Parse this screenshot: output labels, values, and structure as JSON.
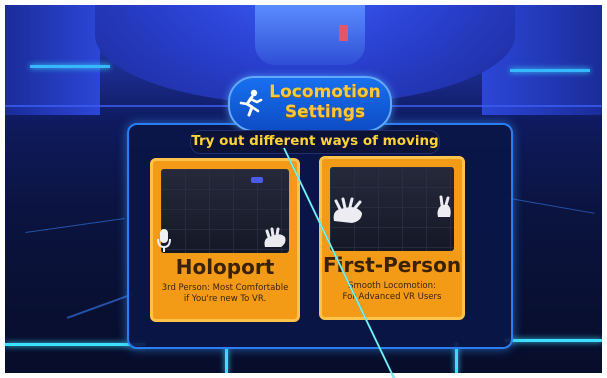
{
  "panel": {
    "title": "Locomotion Settings",
    "title_line1": "Locomotion",
    "title_line2": "Settings",
    "subtitle": "Try out different ways of moving"
  },
  "options": [
    {
      "title": "Holoport",
      "desc_line1": "3rd Person: Most Comfortable",
      "desc_line2": "if You're new To VR."
    },
    {
      "title": "First-Person",
      "desc_line1": "Smooth Locomotion:",
      "desc_line2": "For Advanced VR Users"
    }
  ],
  "icons": {
    "title": "runner-icon",
    "left_card": "microphone-icon"
  },
  "colors": {
    "card": "#f39a17",
    "card_border": "#ffc24a",
    "title_text": "#ffc83a",
    "panel_border": "#2b7df2",
    "pointer_ray": "#3de0e8"
  }
}
